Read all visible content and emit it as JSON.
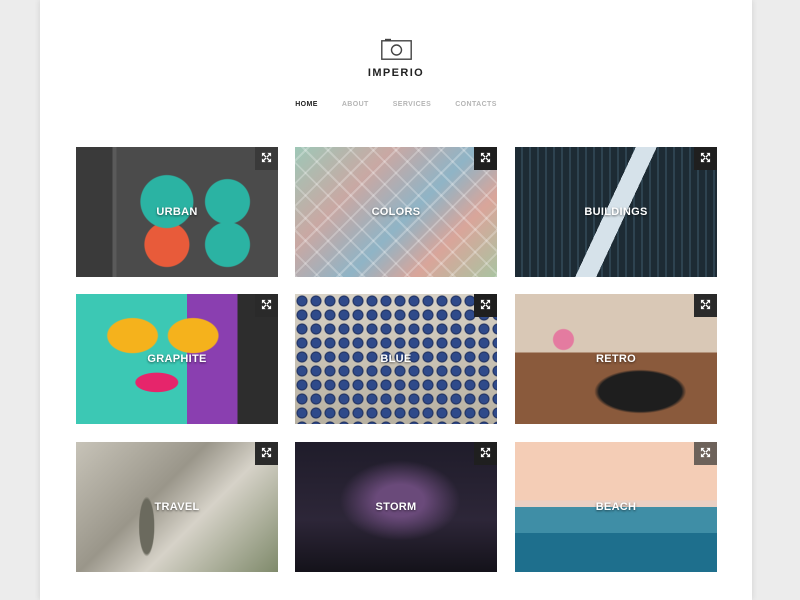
{
  "brand": {
    "name": "IMPERIO",
    "icon": "camera-icon"
  },
  "nav": {
    "items": [
      {
        "label": "HOME",
        "active": true
      },
      {
        "label": "ABOUT",
        "active": false
      },
      {
        "label": "SERVICES",
        "active": false
      },
      {
        "label": "CONTACTS",
        "active": false
      }
    ]
  },
  "gallery": {
    "tiles": [
      {
        "label": "URBAN",
        "expand_bg": "#3a3a3a"
      },
      {
        "label": "COLORS",
        "expand_bg": "#1f1f1f"
      },
      {
        "label": "BUILDINGS",
        "expand_bg": "#1f1f1f"
      },
      {
        "label": "GRAPHITE",
        "expand_bg": "#2a2a2a"
      },
      {
        "label": "BLUE",
        "expand_bg": "#1f1f1f"
      },
      {
        "label": "RETRO",
        "expand_bg": "#2a2a2a"
      },
      {
        "label": "TRAVEL",
        "expand_bg": "#2a2a2a"
      },
      {
        "label": "STORM",
        "expand_bg": "#1f1f1f"
      },
      {
        "label": "BEACH",
        "expand_bg": "#6d625a"
      }
    ],
    "expand_icon": "expand-icon"
  },
  "colors": {
    "text_dark": "#222222",
    "text_muted": "#b5b5b5",
    "page_bg": "#ffffff",
    "outer_bg": "#ececec"
  }
}
